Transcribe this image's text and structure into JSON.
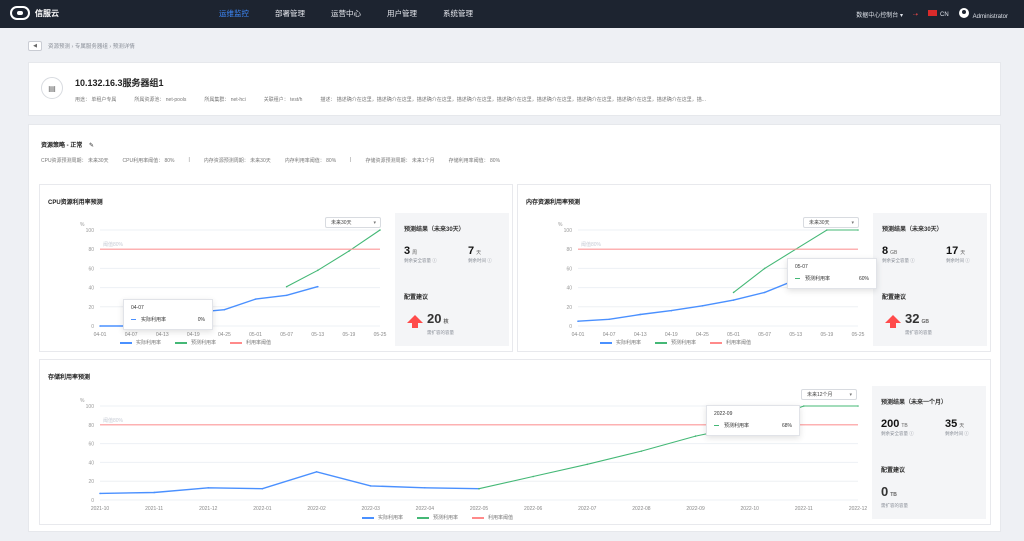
{
  "app": {
    "logo": "信服云",
    "nav": [
      "运维监控",
      "部署管理",
      "运营中心",
      "用户管理",
      "系统管理"
    ],
    "active_nav": 0,
    "datacenter": "数据中心控制台",
    "language": "CN",
    "user": "Administrator"
  },
  "breadcrumb": "资源预测 › 专属服务器组 › 预测详情",
  "server": {
    "title": "10.132.16.3服务器组1",
    "meta": [
      "用途：  单租户专属",
      "所属资源池：  net-pools",
      "所属集群：  net-hci",
      "关联租户：  test/h",
      "描述：  描述确介在这里，描述确介在这里，描述确介在这里，描述确介在这里，描述确介在这里，描述确介在这里，描述确介在这里，描述确介在这里，描述确介在这里，描..."
    ]
  },
  "strategy": {
    "title": "资源策略 - 正常",
    "items": [
      "CPU资源预测周期：  未来30天",
      "CPU利用率阈值：  80%",
      "|",
      "内存资源预测周期：  未来30天",
      "内存利用率阈值：  80%",
      "|",
      "存储资源预测周期：  未来1个月",
      "存储利用率阈值：  80%"
    ]
  },
  "legend": {
    "actual": "实际利用率",
    "predicted": "预测利用率",
    "threshold": "利用率阈值"
  },
  "colors": {
    "blue": "#4a90ff",
    "green": "#44b876",
    "red": "#ff6b6b",
    "threshold": "#ff9a9a",
    "grid": "#edf0f4"
  },
  "cpu": {
    "title": "CPU资源利用率预测",
    "select": "未来30天",
    "result_title": "预测结果（未来30天）",
    "metric1": {
      "value": "3",
      "unit": "周",
      "cap": "剩余安全容量 ⓘ"
    },
    "metric2": {
      "value": "7",
      "unit": "天",
      "cap": "剩余时间 ⓘ"
    },
    "advice_title": "配置建议",
    "advice": {
      "value": "20",
      "unit": "核",
      "cap": "需扩容的容量"
    },
    "tooltip": {
      "date": "04-07",
      "label": "实际利用率",
      "value": "0%"
    }
  },
  "memory": {
    "title": "内存资源利用率预测",
    "select": "未来30天",
    "result_title": "预测结果（未来30天）",
    "metric1": {
      "value": "8",
      "unit": "GB",
      "cap": "剩余安全容量 ⓘ"
    },
    "metric2": {
      "value": "17",
      "unit": "天",
      "cap": "剩余时间 ⓘ"
    },
    "advice_title": "配置建议",
    "advice": {
      "value": "32",
      "unit": "GB",
      "cap": "需扩容的容量"
    },
    "tooltip": {
      "date": "05-07",
      "label": "预测利用率",
      "value": "60%"
    }
  },
  "storage": {
    "title": "存储利用率预测",
    "select": "未来12个月",
    "result_title": "预测结果（未来一个月）",
    "metric1": {
      "value": "200",
      "unit": "TB",
      "cap": "剩余安全容量 ⓘ"
    },
    "metric2": {
      "value": "35",
      "unit": "天",
      "cap": "剩余时间 ⓘ"
    },
    "advice_title": "配置建议",
    "advice": {
      "value": "0",
      "unit": "TB",
      "cap": "需扩容的容量"
    },
    "tooltip": {
      "date": "2022-09",
      "label": "预测利用率",
      "value": "68%"
    }
  },
  "chart_data": [
    {
      "type": "line",
      "title": "CPU资源利用率预测",
      "x": [
        "04-01",
        "04-07",
        "04-13",
        "04-19",
        "04-25",
        "05-01",
        "05-07",
        "05-13",
        "05-19",
        "05-25"
      ],
      "y_ticks": [
        "0",
        "20",
        "40",
        "60",
        "80",
        "100"
      ],
      "ylabel": "%",
      "ylim": [
        0,
        100
      ],
      "threshold_label": "阈值80%",
      "series": [
        {
          "name": "实际利用率",
          "values": [
            0,
            0,
            9,
            14,
            17,
            28,
            32,
            41,
            null,
            null
          ]
        },
        {
          "name": "预测利用率",
          "values": [
            null,
            null,
            null,
            null,
            null,
            null,
            41,
            58,
            78,
            100
          ]
        },
        {
          "name": "利用率阈值",
          "values": [
            80,
            80,
            80,
            80,
            80,
            80,
            80,
            80,
            80,
            80
          ]
        }
      ]
    },
    {
      "type": "line",
      "title": "内存资源利用率预测",
      "x": [
        "04-01",
        "04-07",
        "04-13",
        "04-19",
        "04-25",
        "05-01",
        "05-07",
        "05-13",
        "05-19",
        "05-25"
      ],
      "y_ticks": [
        "0",
        "20",
        "40",
        "60",
        "80",
        "100"
      ],
      "ylabel": "%",
      "ylim": [
        0,
        100
      ],
      "threshold_label": "阈值80%",
      "series": [
        {
          "name": "实际利用率",
          "values": [
            5,
            7,
            12,
            16,
            21,
            27,
            35,
            48,
            null,
            null
          ]
        },
        {
          "name": "预测利用率",
          "values": [
            null,
            null,
            null,
            null,
            null,
            35,
            60,
            80,
            100,
            100
          ]
        },
        {
          "name": "利用率阈值",
          "values": [
            80,
            80,
            80,
            80,
            80,
            80,
            80,
            80,
            80,
            80
          ]
        }
      ]
    },
    {
      "type": "line",
      "title": "存储利用率预测",
      "x": [
        "2021-10",
        "2021-11",
        "2021-12",
        "2022-01",
        "2022-02",
        "2022-03",
        "2022-04",
        "2022-05",
        "2022-06",
        "2022-07",
        "2022-08",
        "2022-09",
        "2022-10",
        "2022-11",
        "2022-12"
      ],
      "y_ticks": [
        "0",
        "20",
        "40",
        "60",
        "80",
        "100"
      ],
      "ylabel": "%",
      "ylim": [
        0,
        100
      ],
      "threshold_label": "阈值80%",
      "series": [
        {
          "name": "实际利用率",
          "values": [
            7,
            8,
            13,
            12,
            30,
            15,
            13,
            12,
            null,
            null,
            null,
            null,
            null,
            null,
            null
          ]
        },
        {
          "name": "预测利用率",
          "values": [
            null,
            null,
            null,
            null,
            null,
            null,
            null,
            12,
            25,
            38,
            52,
            68,
            80,
            100,
            100
          ]
        },
        {
          "name": "利用率阈值",
          "values": [
            80,
            80,
            80,
            80,
            80,
            80,
            80,
            80,
            80,
            80,
            80,
            80,
            80,
            80,
            80
          ]
        }
      ]
    }
  ]
}
